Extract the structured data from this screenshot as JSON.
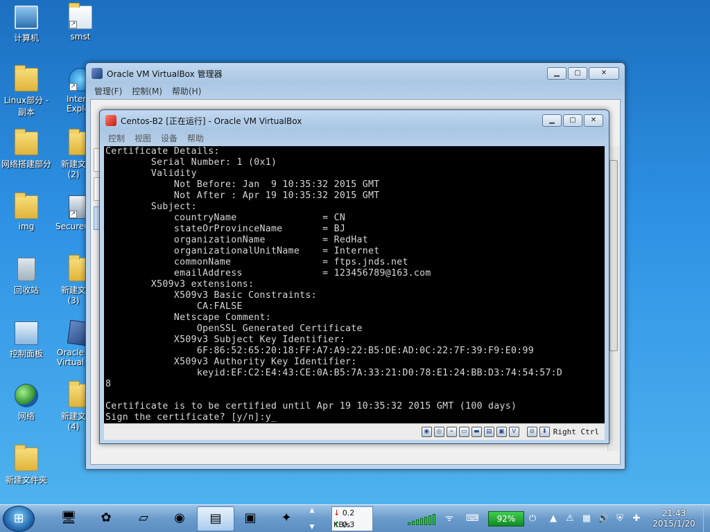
{
  "desktop_icons": [
    {
      "label": "计算机",
      "icon": "computer-icon"
    },
    {
      "label": "smst",
      "icon": "shortcut-icon"
    },
    {
      "label": "Linux部分 - 副本",
      "icon": "folder-icon"
    },
    {
      "label": "Inter Explo",
      "icon": "ie-icon"
    },
    {
      "label": "网络搭建部分",
      "icon": "folder-icon"
    },
    {
      "label": "新建文 (2)",
      "icon": "folder-icon"
    },
    {
      "label": "img",
      "icon": "folder-icon"
    },
    {
      "label": "SecureC",
      "icon": "securecrt-icon"
    },
    {
      "label": "回收站",
      "icon": "recycle-bin-icon"
    },
    {
      "label": "新建文 (3)",
      "icon": "folder-icon"
    },
    {
      "label": "控制面板",
      "icon": "control-panel-icon"
    },
    {
      "label": "Oracle Virtual",
      "icon": "virtualbox-icon"
    },
    {
      "label": "网络",
      "icon": "network-icon"
    },
    {
      "label": "新建文 (4)",
      "icon": "folder-icon"
    },
    {
      "label": "新建文件夹",
      "icon": "folder-icon"
    }
  ],
  "manager_window": {
    "title": "Oracle VM VirtualBox 管理器",
    "menu": [
      "管理(F)",
      "控制(M)",
      "帮助(H)"
    ]
  },
  "vm_window": {
    "title": "Centos-B2 [正在运行] - Oracle VM VirtualBox",
    "menu": [
      "控制",
      "视图",
      "设备",
      "帮助"
    ],
    "host_key": "Right Ctrl"
  },
  "terminal_lines": [
    "Certificate Details:",
    "        Serial Number: 1 (0x1)",
    "        Validity",
    "            Not Before: Jan  9 10:35:32 2015 GMT",
    "            Not After : Apr 19 10:35:32 2015 GMT",
    "        Subject:",
    "            countryName               = CN",
    "            stateOrProvinceName       = BJ",
    "            organizationName          = RedHat",
    "            organizationalUnitName    = Internet",
    "            commonName                = ftps.jnds.net",
    "            emailAddress              = 123456789@163.com",
    "        X509v3 extensions:",
    "            X509v3 Basic Constraints:",
    "                CA:FALSE",
    "            Netscape Comment:",
    "                OpenSSL Generated Certificate",
    "            X509v3 Subject Key Identifier:",
    "                6F:86:52:65:20:18:FF:A7:A9:22:B5:DE:AD:0C:22:7F:39:F9:E0:99",
    "            X509v3 Authority Key Identifier:",
    "                keyid:EF:C2:E4:43:CE:0A:B5:7A:33:21:D0:78:E1:24:BB:D3:74:54:57:D",
    "8",
    "",
    "Certificate is to be certified until Apr 19 10:35:32 2015 GMT (100 days)",
    "Sign the certificate? [y/n]:y_"
  ],
  "taskbar": {
    "net_down": "0.2 KB/s",
    "net_up": "0.3 KB/s",
    "battery": "92%",
    "time": "21:43",
    "date": "2015/1/20"
  },
  "colors": {
    "terminal_bg": "#000000",
    "terminal_fg": "#d8d8d8"
  }
}
